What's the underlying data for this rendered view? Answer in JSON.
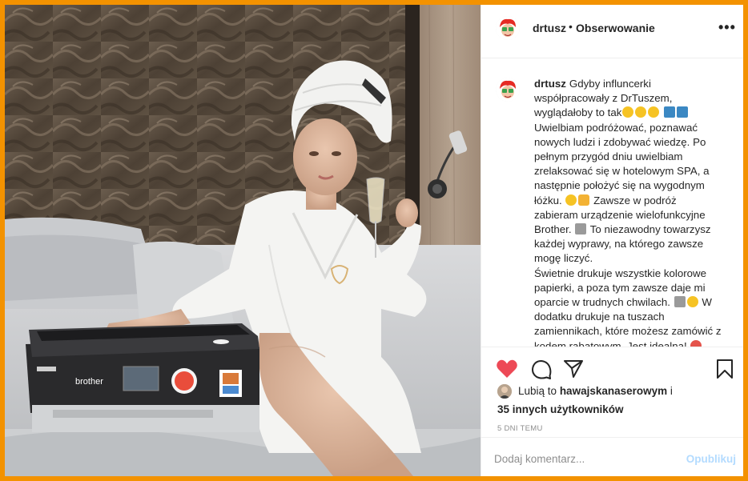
{
  "post": {
    "username": "drtusz",
    "separator": "•",
    "follow_label": "Obserwowanie",
    "more_icon": "more-icon",
    "caption": {
      "username": "drtusz",
      "lines": [
        "Gdyby influncerki współpracowały z DrTuszem, wyglądałoby to tak",
        "Uwielbiam podróżować, poznawać nowych ludzi i zdobywać wiedzę. Po pełnym przygód dniu uwielbiam zrelaksować się w hotelowym SPA, a następnie położyć się na wygodnym łóżku.",
        "Zawsze w podróż zabieram urządzenie wielofunkcyjne Brother.",
        "To niezawodny towarzysz każdej wyprawy, na którego zawsze mogę liczyć.",
        "Świetnie drukuje wszystkie kolorowe papierki, a poza tym zawsze daje mi oparcie w trudnych chwilach.",
        "W dodatku drukuje na tuszach zamiennikach, które możesz zamówić z kodem rabatowym. Jest idealna!"
      ]
    },
    "likes": {
      "prefix": "Lubią to",
      "user": "hawajskanaserowym",
      "suffix": "i",
      "others": "35 innych użytkowników"
    },
    "time": "5 DNI TEMU",
    "comment": {
      "placeholder": "Dodaj komentarz...",
      "post_label": "Opublikuj"
    }
  },
  "colors": {
    "frame": "#f39200",
    "like": "#ed4956",
    "link": "#b3dbff",
    "muted": "#8e8e8e",
    "text": "#262626"
  },
  "photo": {
    "printer_brand": "brother"
  }
}
